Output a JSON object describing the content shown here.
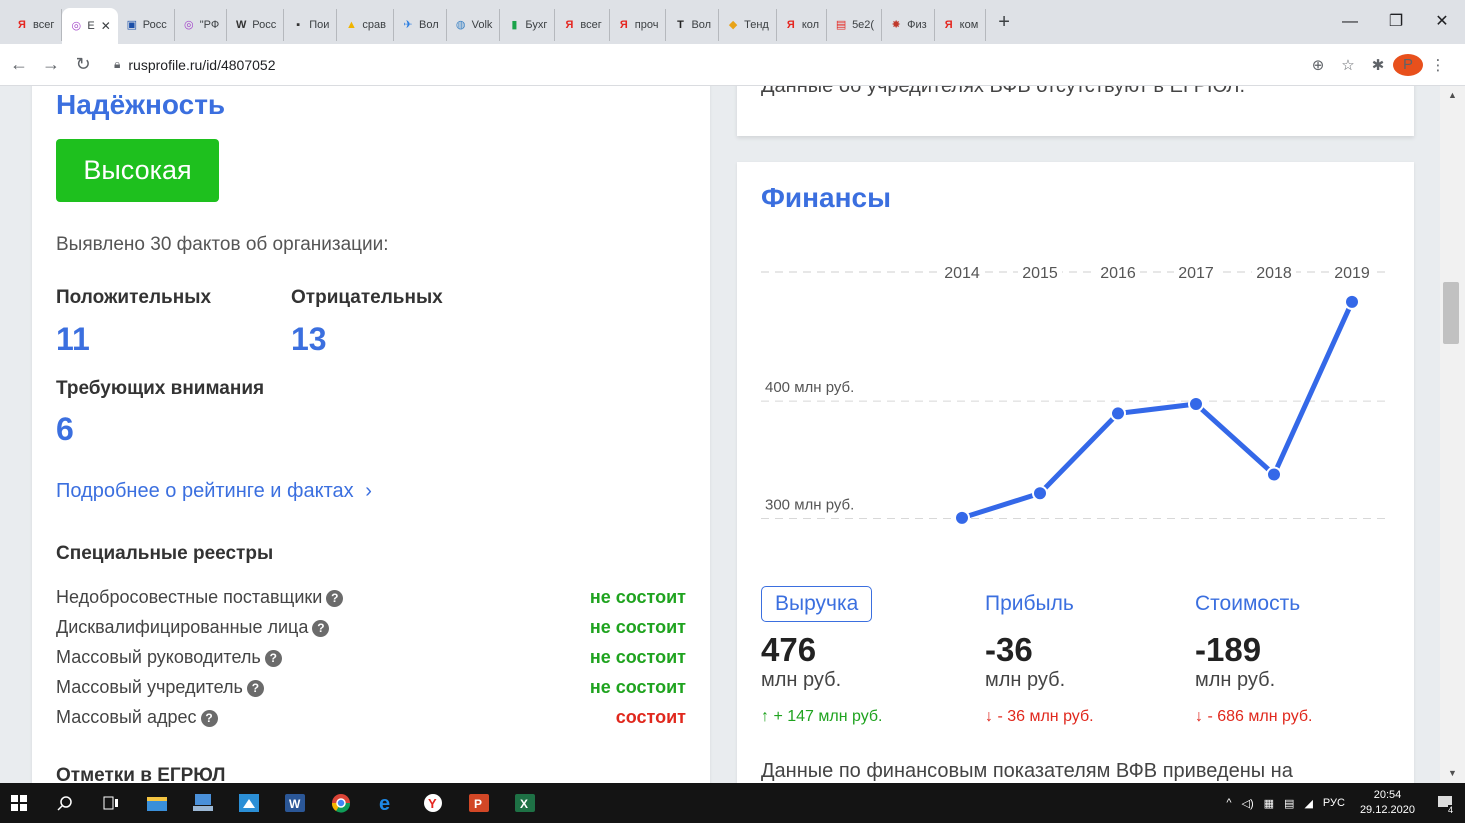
{
  "browser": {
    "tabs": [
      {
        "label": "всег",
        "icon": "yandex-icon",
        "color": "#e52620",
        "glyph": "Я"
      },
      {
        "label": "Е",
        "icon": "rusprofile-icon",
        "color": "#a243c9",
        "glyph": "◎",
        "active": true
      },
      {
        "label": "Росс",
        "icon": "ru-icon",
        "color": "#1b4fa8",
        "glyph": "▣"
      },
      {
        "label": "\"РФ",
        "icon": "rusprofile-icon",
        "color": "#a243c9",
        "glyph": "◎"
      },
      {
        "label": "Росс",
        "icon": "wikipedia-icon",
        "color": "#333333",
        "glyph": "W"
      },
      {
        "label": "Пои",
        "icon": "rbc-icon",
        "color": "#333333",
        "glyph": "▪"
      },
      {
        "label": "срав",
        "icon": "chart-icon",
        "color": "#f0b400",
        "glyph": "▲"
      },
      {
        "label": "Вол",
        "icon": "plane-icon",
        "color": "#2a7de1",
        "glyph": "✈"
      },
      {
        "label": "Volk",
        "icon": "globe-icon",
        "color": "#3b82c4",
        "glyph": "◍"
      },
      {
        "label": "Бухг",
        "icon": "buh-icon",
        "color": "#1aa34a",
        "glyph": "▮"
      },
      {
        "label": "всег",
        "icon": "yandex-icon",
        "color": "#e52620",
        "glyph": "Я"
      },
      {
        "label": "проч",
        "icon": "yandex-icon",
        "color": "#e52620",
        "glyph": "Я"
      },
      {
        "label": "Вол",
        "icon": "t-icon",
        "color": "#222222",
        "glyph": "T"
      },
      {
        "label": "Тенд",
        "icon": "cap-icon",
        "color": "#e8a317",
        "glyph": "◆"
      },
      {
        "label": "кол",
        "icon": "yandex-icon",
        "color": "#e52620",
        "glyph": "Я"
      },
      {
        "label": "5e2(",
        "icon": "pdf-icon",
        "color": "#e52620",
        "glyph": "▤"
      },
      {
        "label": "Физ",
        "icon": "emblem-icon",
        "color": "#c0392b",
        "glyph": "✸"
      },
      {
        "label": "ком",
        "icon": "yandex-icon",
        "color": "#e52620",
        "glyph": "Я"
      }
    ],
    "new_tab": "+",
    "url": "rusprofile.ru/id/4807052"
  },
  "left": {
    "reliability_title": "Надёжность",
    "reliability_badge": "Высокая",
    "facts_text": "Выявлено 30 фактов об организации:",
    "positive_label": "Положительных",
    "positive_value": "11",
    "negative_label": "Отрицательных",
    "negative_value": "13",
    "attention_label": "Требующих внимания",
    "attention_value": "6",
    "more_link": "Подробнее о рейтинге и фактах",
    "registries_title": "Специальные реестры",
    "registries": [
      {
        "name": "Недобросовестные поставщики",
        "status": "не состоит",
        "positive": true
      },
      {
        "name": "Дисквалифицированные лица",
        "status": "не состоит",
        "positive": true
      },
      {
        "name": "Массовый руководитель",
        "status": "не состоит",
        "positive": true
      },
      {
        "name": "Массовый учредитель",
        "status": "не состоит",
        "positive": true
      },
      {
        "name": "Массовый адрес",
        "status": "состоит",
        "positive": false
      }
    ],
    "egrul_title": "Отметки в ЕГРЮЛ"
  },
  "right": {
    "founders_text": "Данные об учредителях ВФВ отсутствуют в ЕГРЮЛ.",
    "finance_title": "Финансы",
    "tabs": [
      "Выручка",
      "Прибыль",
      "Стоимость"
    ],
    "metrics": [
      {
        "value": "476",
        "unit": "млн руб.",
        "delta": "↑ + 147 млн руб.",
        "dir": "up"
      },
      {
        "value": "-36",
        "unit": "млн руб.",
        "delta": "↓ - 36 млн руб.",
        "dir": "down"
      },
      {
        "value": "-189",
        "unit": "млн руб.",
        "delta": "↓ - 686 млн руб.",
        "dir": "down"
      }
    ],
    "footer_text": "Данные по финансовым показателям ВФВ приведены на"
  },
  "chart_data": {
    "type": "line",
    "categories": [
      "2014",
      "2015",
      "2016",
      "2017",
      "2018",
      "2019"
    ],
    "series": [
      {
        "values": [
          292,
          313,
          381,
          389,
          329,
          476
        ]
      }
    ],
    "ytick_labels": [
      "300 млн руб.",
      "400 млн руб."
    ],
    "yticks": [
      300,
      400
    ],
    "ylim": [
      280,
      510
    ],
    "line_color": "#3468e8"
  },
  "taskbar": {
    "tray_lang": "РУС",
    "time": "20:54",
    "date": "29.12.2020",
    "notif_count": "4"
  }
}
